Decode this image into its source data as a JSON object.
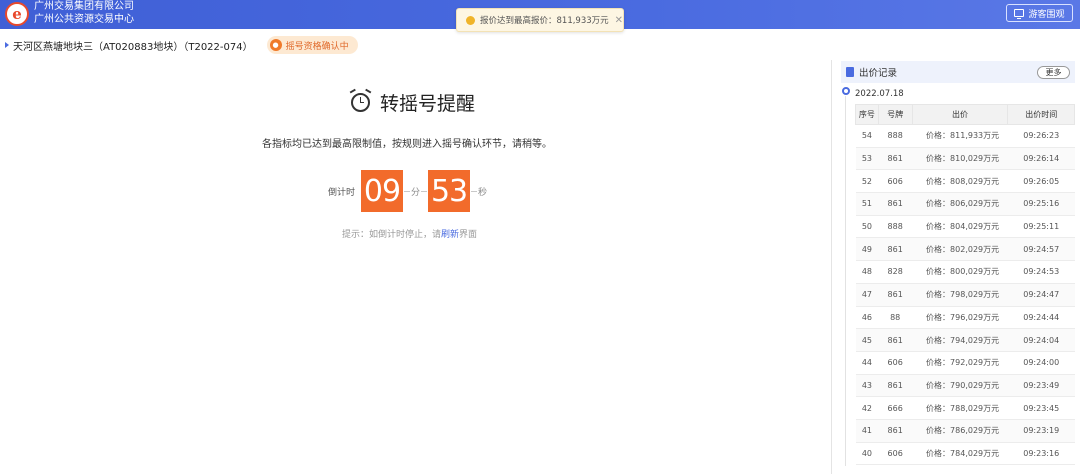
{
  "header": {
    "logo_letter": "e",
    "org_name_1": "广州交易集团有限公司",
    "org_name_2": "广州公共资源交易中心",
    "visitor_label": "游客围观"
  },
  "toast": {
    "message": "报价达到最高报价：811,933万元",
    "close_glyph": "✕"
  },
  "title_bar": {
    "title": "天河区燕塘地块三（AT020883地块）（T2022-074）",
    "status": "摇号资格确认中"
  },
  "reminder": {
    "title": "转摇号提醒",
    "description": "各指标均已达到最高限制值，按规则进入摇号确认环节，请稍等。",
    "countdown_label": "倒计时",
    "minutes": "09",
    "minutes_unit": "分",
    "seconds": "53",
    "seconds_unit": "秒",
    "hint_prefix": "提示：如倒计时停止，请",
    "hint_link": "刷新",
    "hint_suffix": "界面"
  },
  "bid_panel": {
    "title": "出价记录",
    "more_label": "更多",
    "date": "2022.07.18",
    "columns": [
      "序号",
      "号牌",
      "出价",
      "出价时间"
    ],
    "rows": [
      {
        "seq": "54",
        "plate": "888",
        "price": "价格：811,933万元",
        "time": "09:26:23"
      },
      {
        "seq": "53",
        "plate": "861",
        "price": "价格：810,029万元",
        "time": "09:26:14"
      },
      {
        "seq": "52",
        "plate": "606",
        "price": "价格：808,029万元",
        "time": "09:26:05"
      },
      {
        "seq": "51",
        "plate": "861",
        "price": "价格：806,029万元",
        "time": "09:25:16"
      },
      {
        "seq": "50",
        "plate": "888",
        "price": "价格：804,029万元",
        "time": "09:25:11"
      },
      {
        "seq": "49",
        "plate": "861",
        "price": "价格：802,029万元",
        "time": "09:24:57"
      },
      {
        "seq": "48",
        "plate": "828",
        "price": "价格：800,029万元",
        "time": "09:24:53"
      },
      {
        "seq": "47",
        "plate": "861",
        "price": "价格：798,029万元",
        "time": "09:24:47"
      },
      {
        "seq": "46",
        "plate": "88",
        "price": "价格：796,029万元",
        "time": "09:24:44"
      },
      {
        "seq": "45",
        "plate": "861",
        "price": "价格：794,029万元",
        "time": "09:24:04"
      },
      {
        "seq": "44",
        "plate": "606",
        "price": "价格：792,029万元",
        "time": "09:24:00"
      },
      {
        "seq": "43",
        "plate": "861",
        "price": "价格：790,029万元",
        "time": "09:23:49"
      },
      {
        "seq": "42",
        "plate": "666",
        "price": "价格：788,029万元",
        "time": "09:23:45"
      },
      {
        "seq": "41",
        "plate": "861",
        "price": "价格：786,029万元",
        "time": "09:23:19"
      },
      {
        "seq": "40",
        "plate": "606",
        "price": "价格：784,029万元",
        "time": "09:23:16"
      }
    ]
  },
  "icons": {
    "logo": "e-logo-icon",
    "visitor": "monitor-icon",
    "toast": "warning-dot-icon",
    "status": "bell-icon",
    "reminder": "alarm-clock-icon",
    "panel": "document-icon"
  },
  "colors": {
    "header_blue": "#4a6be0",
    "countdown_orange": "#f26b2b",
    "status_bg": "#fde9d2",
    "toast_bg": "#fdf6e3"
  }
}
